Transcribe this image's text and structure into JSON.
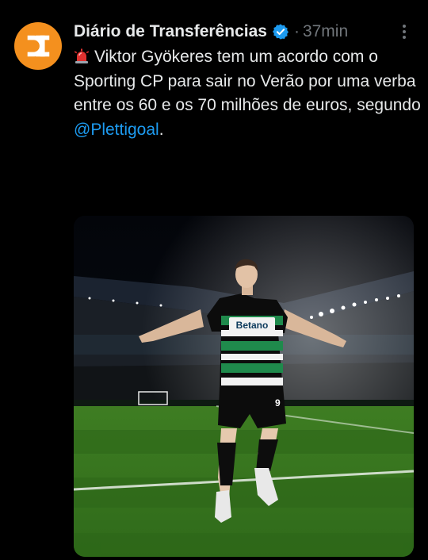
{
  "tweet": {
    "author_name": "Diário de Transferências",
    "time_separator": "·",
    "time": "37min",
    "text_main": "Viktor Gyökeres tem um acordo com o Sporting CP para sair no Verão por uma verba entre os 60 e os 70 milhões de euros, segundo ",
    "mention": "@Plettigoal",
    "text_end": "."
  },
  "icons": {
    "avatar": "dt-logo-icon",
    "verified": "verified-badge-icon",
    "more": "more-options-icon",
    "siren": "siren-emoji-icon"
  },
  "media": {
    "jersey_sponsor": "Betano",
    "shorts_number": "9"
  },
  "colors": {
    "avatar_bg": "#f4901e",
    "mention": "#1d9bf0",
    "verified": "#1d9bf0",
    "secondary_text": "#71767b"
  }
}
